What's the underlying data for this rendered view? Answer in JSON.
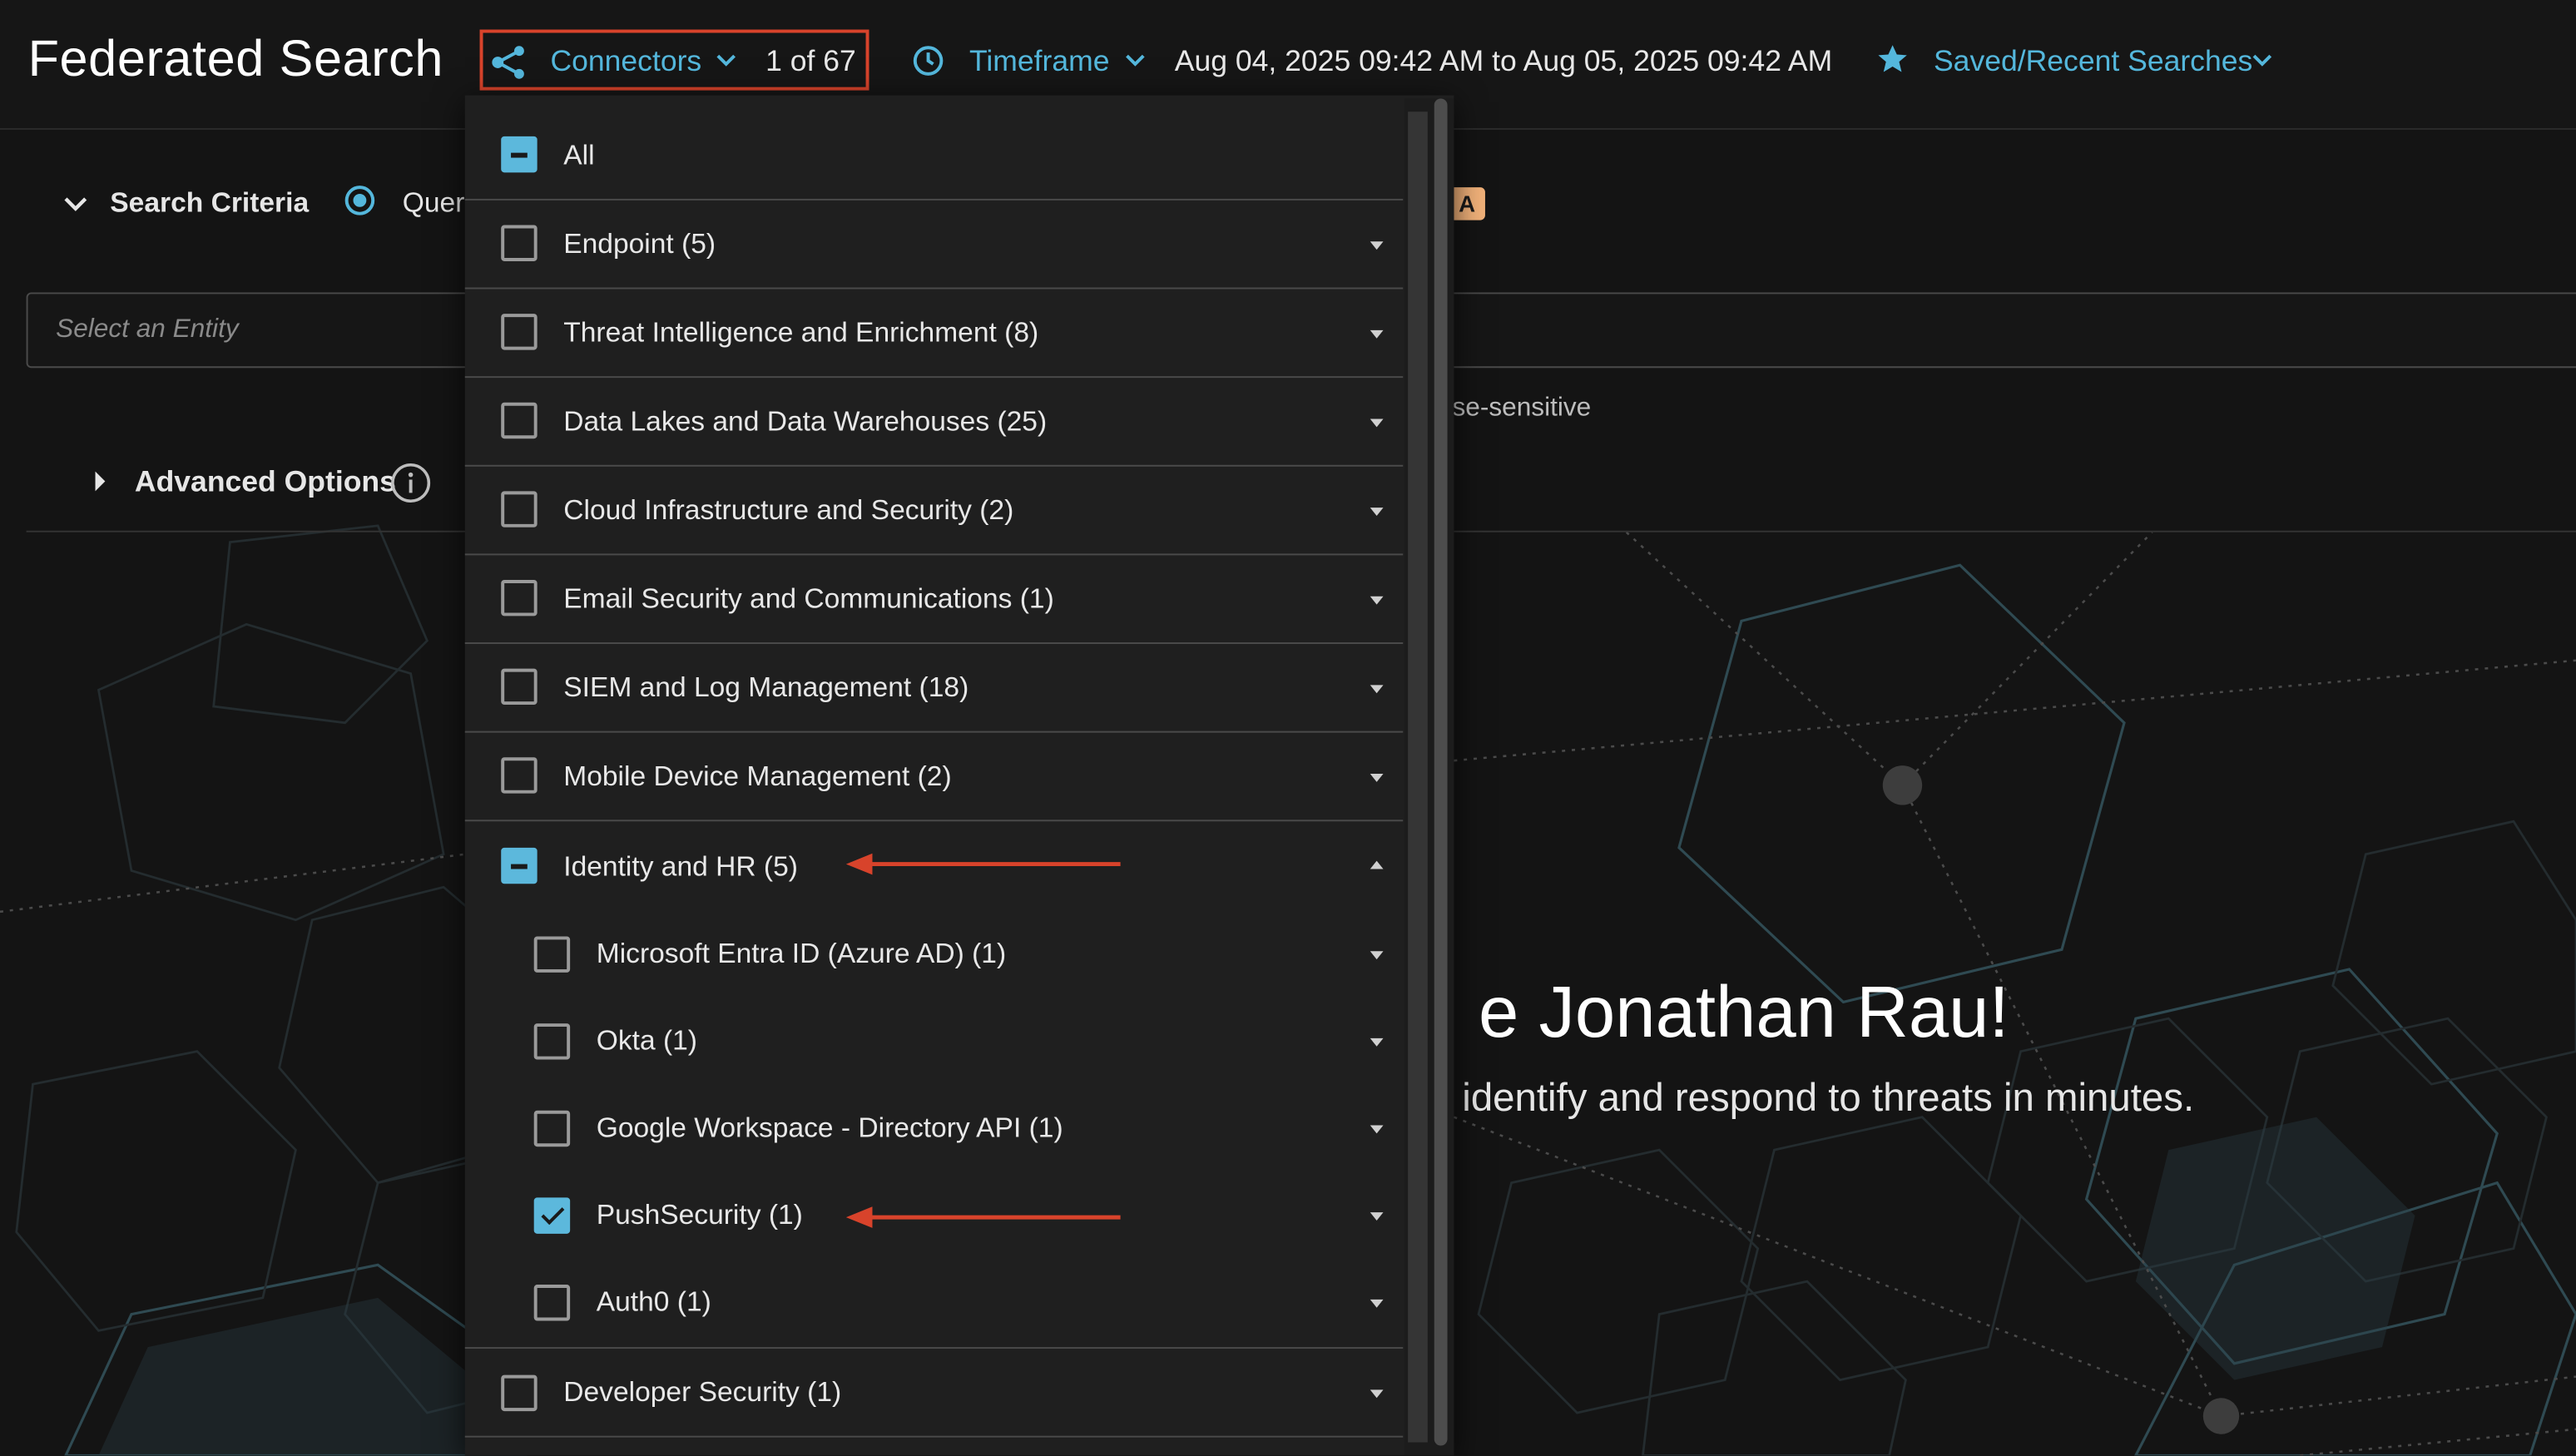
{
  "header": {
    "title": "Federated Search",
    "connectors_label": "Connectors",
    "connectors_count": "1 of 67",
    "timeframe_label": "Timeframe",
    "timeframe_range": "Aug 04, 2025 09:42 AM to Aug 05, 2025 09:42 AM",
    "saved_label": "Saved/Recent Searches"
  },
  "search": {
    "criteria_label": "Search Criteria",
    "query_label_fragment": "Quer",
    "badge_fragment": "A",
    "entity_placeholder": "Select an Entity",
    "case_fragment": "se-sensitive",
    "advanced_options_label": "Advanced Options"
  },
  "welcome": {
    "title_fragment": "e Jonathan Rau!",
    "subtitle_fragment": "identify and respond to threats in minutes."
  },
  "connectors_dropdown": {
    "all_label": "All",
    "all_state": "partial",
    "categories": [
      {
        "label": "Endpoint (5)",
        "state": "unchecked",
        "expanded": false
      },
      {
        "label": "Threat Intelligence and Enrichment (8)",
        "state": "unchecked",
        "expanded": false
      },
      {
        "label": "Data Lakes and Data Warehouses (25)",
        "state": "unchecked",
        "expanded": false
      },
      {
        "label": "Cloud Infrastructure and Security (2)",
        "state": "unchecked",
        "expanded": false
      },
      {
        "label": "Email Security and Communications (1)",
        "state": "unchecked",
        "expanded": false
      },
      {
        "label": "SIEM and Log Management (18)",
        "state": "unchecked",
        "expanded": false
      },
      {
        "label": "Mobile Device Management (2)",
        "state": "unchecked",
        "expanded": false
      },
      {
        "label": "Identity and HR (5)",
        "state": "partial",
        "expanded": true
      },
      {
        "label": "Developer Security (1)",
        "state": "unchecked",
        "expanded": false
      }
    ],
    "identity_children": [
      {
        "label": "Microsoft Entra ID (Azure AD) (1)",
        "state": "unchecked"
      },
      {
        "label": "Okta (1)",
        "state": "unchecked"
      },
      {
        "label": "Google Workspace - Directory API (1)",
        "state": "unchecked"
      },
      {
        "label": "PushSecurity (1)",
        "state": "checked"
      },
      {
        "label": "Auth0 (1)",
        "state": "unchecked"
      }
    ]
  },
  "colors": {
    "accent": "#54b7dc",
    "highlight_box": "#d8432b",
    "annotation_arrow": "#d8432b",
    "badge": "#f2b27a"
  },
  "icons": {
    "connectors": "share-nodes-icon",
    "timeframe": "clock-icon",
    "saved": "star-icon",
    "chevron": "chevron-down-icon",
    "info": "info-icon"
  }
}
